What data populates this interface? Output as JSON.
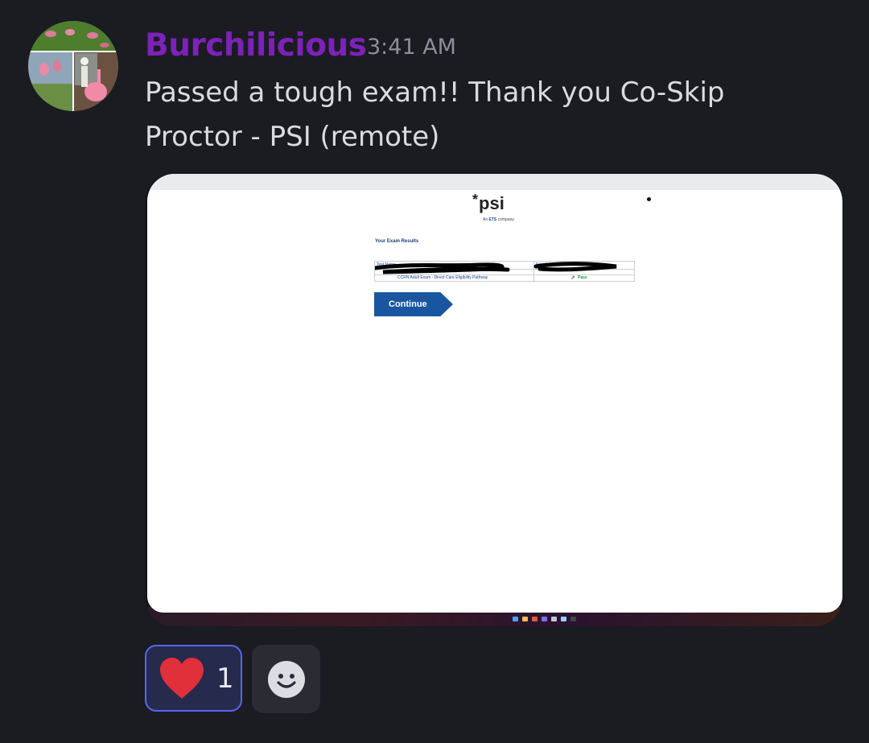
{
  "message": {
    "author": "Burchilicious",
    "timestamp": "3:41 AM",
    "text": "Passed a tough exam!! Thank you Co-Skip Proctor - PSI (remote)",
    "colors": {
      "author": "#7c22b8",
      "timestamp": "#8d8f98",
      "text": "#dadbde"
    }
  },
  "attachment": {
    "logo_text": "psi",
    "logo_star": "*",
    "logo_subtitle_prefix": "An",
    "logo_subtitle_brand": "ETS",
    "logo_subtitle_suffix": "company",
    "results_title": "Your Exam Results",
    "table": {
      "col_test_name": "Test Name",
      "col_result": "Result",
      "exam_name": "CCRN Adult Exam - Direct Care Eligibility Pathway",
      "exam_result": "Pass"
    },
    "continue_label": "Continue",
    "button_color": "#1a56a0"
  },
  "reactions": [
    {
      "emoji": "heart-icon",
      "count": "1",
      "color": "#e0303a",
      "selected": true
    }
  ],
  "add_reaction": {
    "icon": "smiley-icon"
  }
}
